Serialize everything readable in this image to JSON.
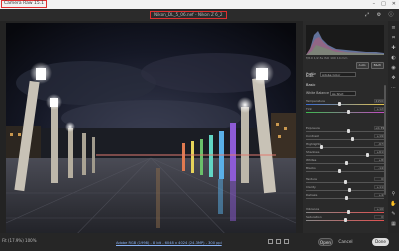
{
  "window": {
    "app_title": "Camera Raw 15.1",
    "file_title": "Nikon_DL_5_06.nef  -  Nikon Z 6_2",
    "controls": [
      "–",
      "□",
      "✕"
    ]
  },
  "status": {
    "zoom": "Fit (17.9%)    100%",
    "meta": "Adobe RGB (1998) - 8 bit - 6048 x 4024 (24.3MP) - 300 ppi",
    "open_label": "Open",
    "cancel_label": "Cancel",
    "done_label": "Done"
  },
  "panel": {
    "histo_info": "f/8.0   1/2.5s   ISO 100   14 mm",
    "edit_label": "Edit",
    "auto_label": "Auto",
    "bw_label": "B&W",
    "profile_label": "Profile",
    "profile_value": "Adobe Color",
    "basic_title": "Basic",
    "wb_label": "White Balance",
    "wb_value": "As Shot",
    "sliders": [
      {
        "label": "Temperature",
        "value": "4150",
        "pos": 0.42,
        "track": "linear-gradient(90deg,#3a6bd1,#e6c44a)"
      },
      {
        "label": "Tint",
        "value": "+12",
        "pos": 0.55,
        "track": "linear-gradient(90deg,#3cba4e,#c34ac2)"
      },
      {
        "label": "Exposure",
        "value": "+0.35",
        "pos": 0.55,
        "track": "#555"
      },
      {
        "label": "Contrast",
        "value": "+19",
        "pos": 0.6,
        "track": "#555"
      },
      {
        "label": "Highlights",
        "value": "-67",
        "pos": 0.18,
        "track": "#555"
      },
      {
        "label": "Shadows",
        "value": "+61",
        "pos": 0.8,
        "track": "#555"
      },
      {
        "label": "Whites",
        "value": "+8",
        "pos": 0.52,
        "track": "#555"
      },
      {
        "label": "Blacks",
        "value": "-14",
        "pos": 0.43,
        "track": "#555"
      },
      {
        "label": "Texture",
        "value": "0",
        "pos": 0.5,
        "track": "#555"
      },
      {
        "label": "Clarity",
        "value": "+11",
        "pos": 0.56,
        "track": "#555"
      },
      {
        "label": "Dehaze",
        "value": "+4",
        "pos": 0.52,
        "track": "#555"
      },
      {
        "label": "Vibrance",
        "value": "+10",
        "pos": 0.55,
        "track": "linear-gradient(90deg,#888,#e05050)"
      },
      {
        "label": "Saturation",
        "value": "0",
        "pos": 0.5,
        "track": "linear-gradient(90deg,#888,#e05050)"
      }
    ]
  },
  "tools": [
    "edit-icon",
    "crop-icon",
    "heal-icon",
    "mask-icon",
    "redeye-icon",
    "presets-icon",
    "more-icon",
    "zoom-icon",
    "hand-icon",
    "sampler-icon",
    "grid-icon"
  ],
  "colors": {
    "accent": "#e03030",
    "panel": "#2a2a2a",
    "bg": "#1e1e1e"
  }
}
